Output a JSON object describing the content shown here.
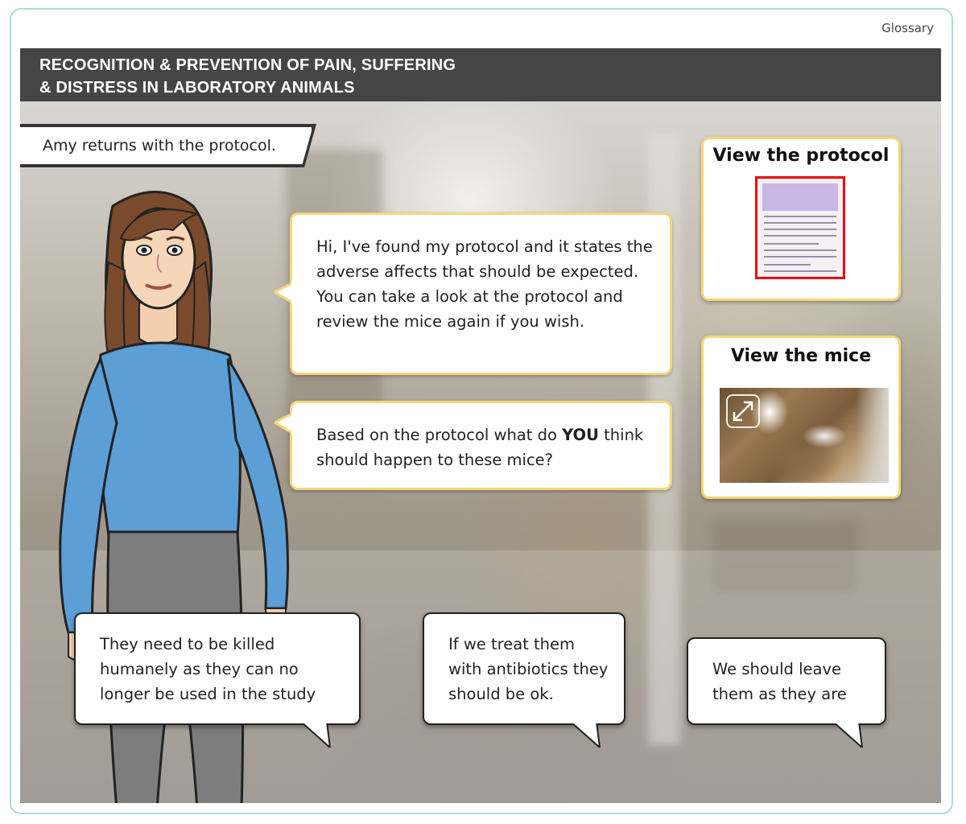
{
  "header": {
    "glossary_label": "Glossary",
    "title_line1": "RECOGNITION & PREVENTION OF PAIN, SUFFERING",
    "title_line2": "& DISTRESS IN LABORATORY ANIMALS"
  },
  "scene": {
    "caption": "Amy returns with the protocol.",
    "speech1": "Hi, I've found my protocol and it states the adverse affects that should be expected. You can take a look at the protocol and review the mice again if you wish.",
    "speech2_before": "Based on the protocol what do ",
    "speech2_bold": "YOU",
    "speech2_after": " think should happen to these mice?"
  },
  "cards": {
    "protocol_title": "View the protocol",
    "mice_title": "View the mice"
  },
  "options": [
    {
      "label": "They need to be killed humanely as they can no longer be used in the study"
    },
    {
      "label": "If we treat them with antibiotics they should be ok."
    },
    {
      "label": "We should leave them as they are"
    }
  ],
  "colors": {
    "title_bar": "#454545",
    "card_border": "#f5d67a",
    "frame_border": "#a8dcd9",
    "doc_highlight": "#ee0000"
  }
}
